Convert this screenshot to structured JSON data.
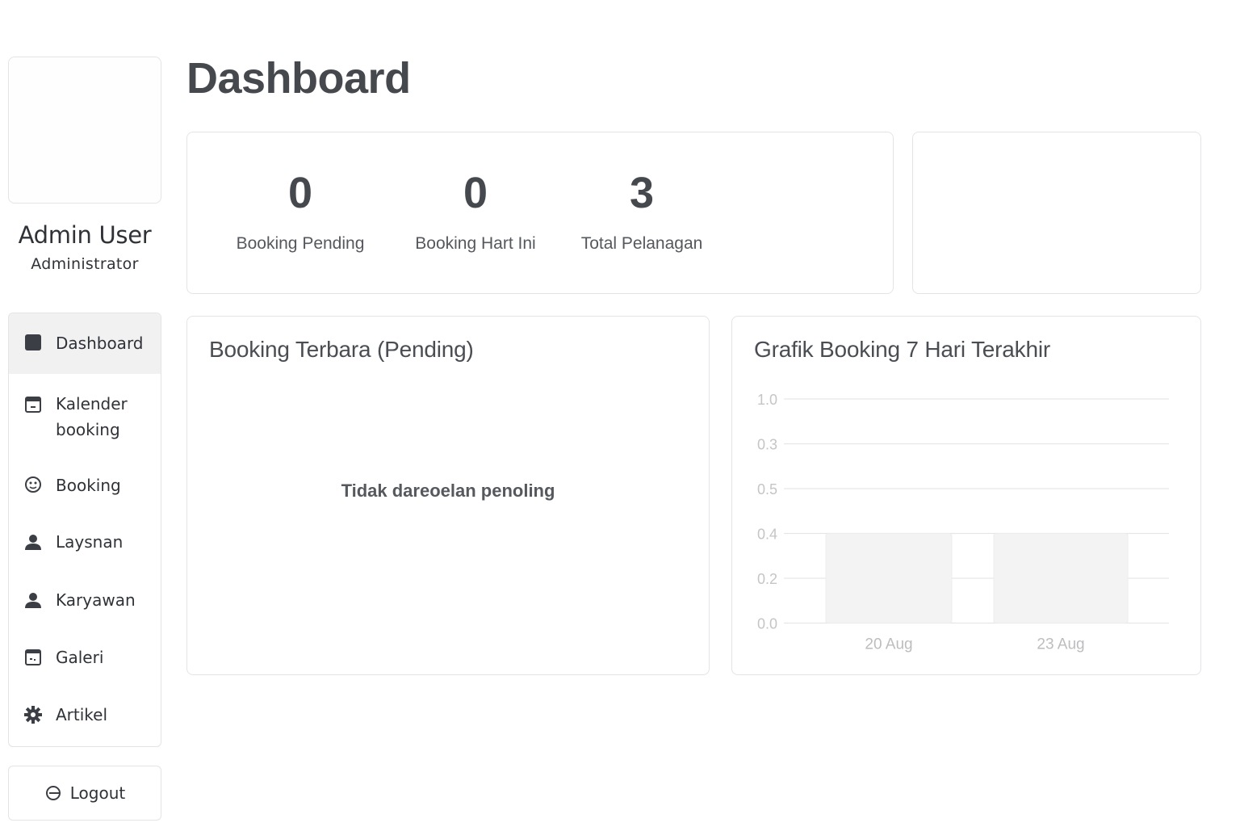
{
  "sidebar": {
    "user_name": "Admin User",
    "user_role": "Administrator",
    "items": [
      {
        "label": "Dashboard",
        "icon": "dashboard-icon"
      },
      {
        "label": "Kalender booking",
        "icon": "calendar-icon"
      },
      {
        "label": "Booking",
        "icon": "booking-icon"
      },
      {
        "label": "Laysnan",
        "icon": "user-icon"
      },
      {
        "label": "Karyawan",
        "icon": "user-icon"
      },
      {
        "label": "Galeri",
        "icon": "gallery-icon"
      },
      {
        "label": "Artikel",
        "icon": "gear-icon"
      }
    ],
    "active_item": "Dashboard",
    "logout_label": "Logout"
  },
  "header": {
    "title": "Dashboard"
  },
  "stats": [
    {
      "value": "0",
      "label": "Booking Pending"
    },
    {
      "value": "0",
      "label": "Booking Hart Ini"
    },
    {
      "value": "3",
      "label": "Total Pelanagan"
    }
  ],
  "pending": {
    "title": "Booking Terbara (Pending)",
    "empty_text": "Tidak dareoelan penoling"
  },
  "chart": {
    "title": "Grafik Booking 7 Hari Terakhir"
  },
  "chart_data": {
    "type": "bar",
    "categories": [
      "20 Aug",
      "23 Aug"
    ],
    "values": [
      0.3,
      0.3
    ],
    "y_ticks": [
      "1.0",
      "0.3",
      "0.5",
      "0.4",
      "0.2",
      "0.0"
    ],
    "grid": true,
    "bar_color": "#f3f3f3",
    "grid_color": "#e6e6e6"
  },
  "colors": {
    "border": "#e3e4e6",
    "active_bg": "#f1f1f2",
    "text": "#3a3d42"
  }
}
